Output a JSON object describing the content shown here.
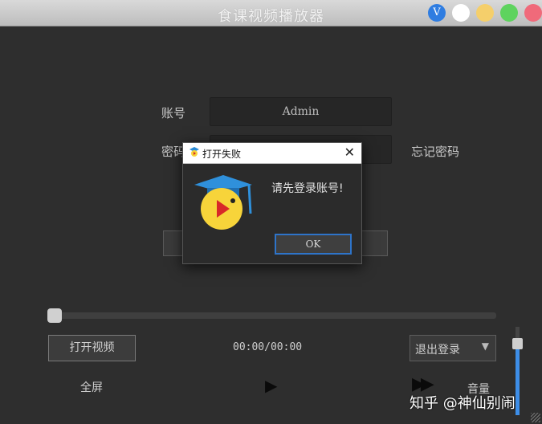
{
  "window": {
    "title": "食课视频播放器",
    "btn_v": "V"
  },
  "login": {
    "account_label": "账号",
    "account_value": "Admin",
    "password_label": "密码",
    "remember_label": "忘记密码"
  },
  "player": {
    "open_video_label": "打开视频",
    "time_display": "00:00/00:00",
    "logout_select_value": "退出登录",
    "fullscreen_label": "全屏",
    "play_symbol": "▶",
    "ffwd_symbol": "▶▶",
    "volume_label": "音量",
    "progress": 0,
    "volume_level": 0.77
  },
  "dialog": {
    "title": "打开失败",
    "message": "请先登录账号!",
    "ok_label": "OK",
    "close_symbol": "✕"
  },
  "watermark": "知乎 @神仙别闹",
  "colors": {
    "accent": "#2f7de1",
    "volume_fill": "#3d8ee8",
    "dialog_border": "#2e74c9"
  },
  "icons": [
    "v-icon",
    "close-icon",
    "graduation-mascot-icon",
    "play-icon",
    "fast-forward-icon",
    "dropdown-arrow-icon",
    "resize-grip-icon"
  ]
}
